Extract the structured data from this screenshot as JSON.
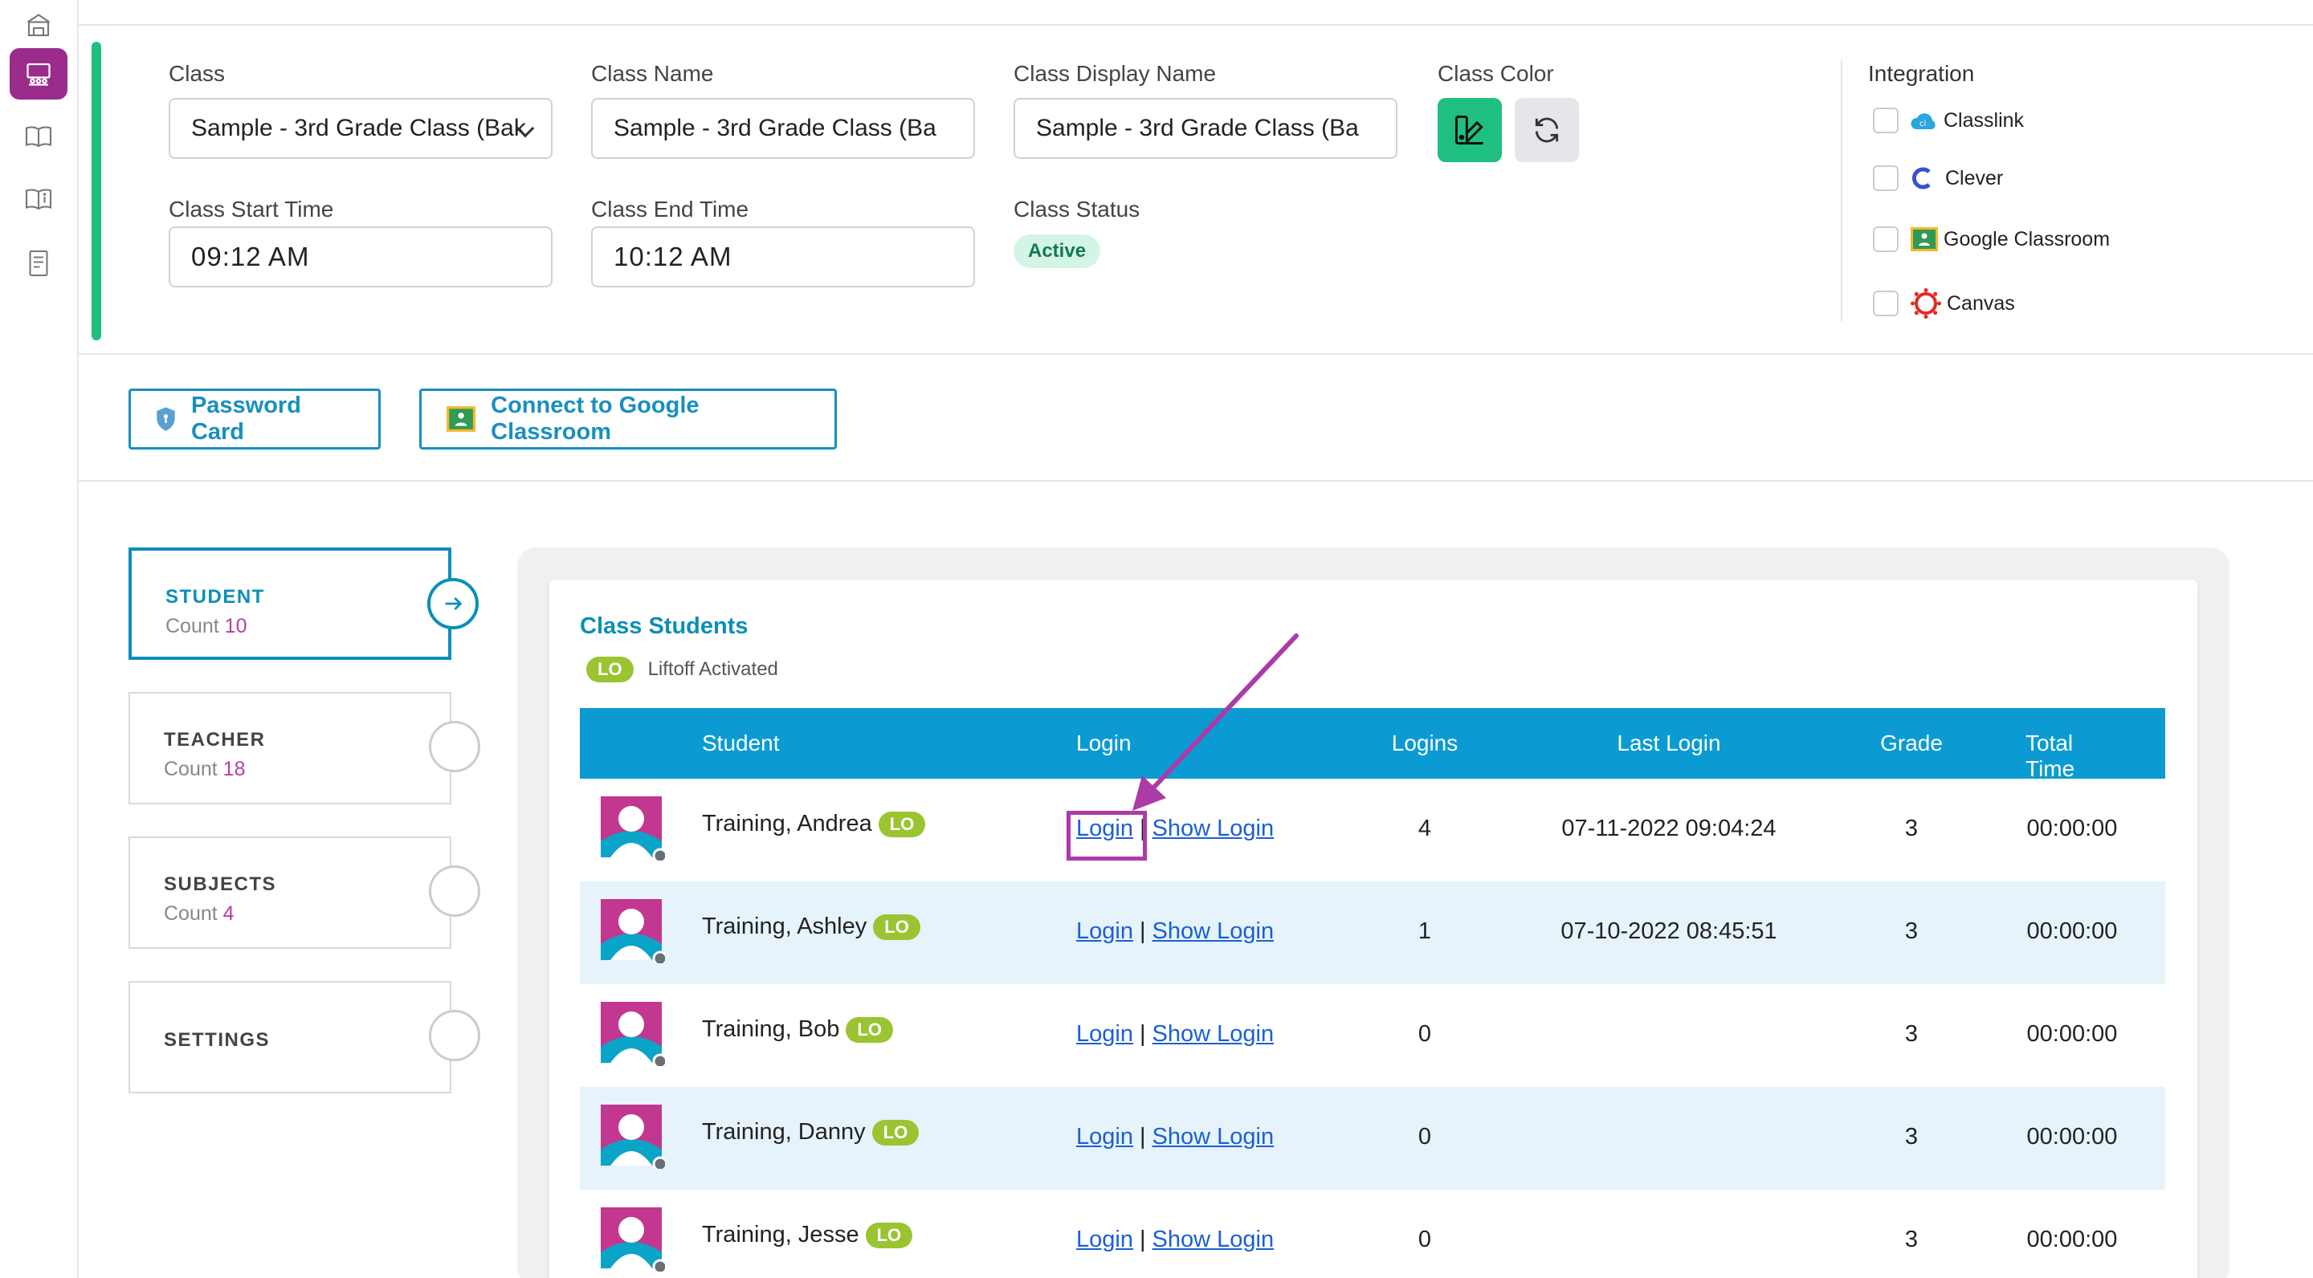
{
  "form": {
    "class_label": "Class",
    "class_value": "Sample - 3rd Grade Class (Bak",
    "class_name_label": "Class Name",
    "class_name_value": "Sample - 3rd Grade Class (Ba",
    "display_name_label": "Class Display Name",
    "display_name_value": "Sample - 3rd Grade Class (Ba",
    "color_label": "Class Color",
    "color_value": "#1fbf7f",
    "start_label": "Class Start Time",
    "start_value": "09:12 AM",
    "end_label": "Class End Time",
    "end_value": "10:12 AM",
    "status_label": "Class Status",
    "status_value": "Active"
  },
  "integration": {
    "title": "Integration",
    "items": [
      "Classlink",
      "Clever",
      "Google Classroom",
      "Canvas"
    ]
  },
  "actions": {
    "password_card": "Password Card",
    "connect_google": "Connect to Google Classroom"
  },
  "tabs": [
    {
      "title": "STUDENT",
      "count_label": "Count",
      "count": "10"
    },
    {
      "title": "TEACHER",
      "count_label": "Count",
      "count": "18"
    },
    {
      "title": "SUBJECTS",
      "count_label": "Count",
      "count": "4"
    },
    {
      "title": "SETTINGS"
    }
  ],
  "students": {
    "title": "Class Students",
    "lo_badge": "LO",
    "lo_legend": "Liftoff Activated",
    "columns": [
      "Student",
      "Login",
      "Logins",
      "Last Login",
      "Grade",
      "Total Time"
    ],
    "login_link": "Login",
    "separator": "|",
    "show_login_link": "Show Login",
    "rows": [
      {
        "name": "Training, Andrea",
        "logins": "4",
        "last_login": "07-11-2022 09:04:24",
        "grade": "3",
        "total_time": "00:00:00"
      },
      {
        "name": "Training, Ashley",
        "logins": "1",
        "last_login": "07-10-2022 08:45:51",
        "grade": "3",
        "total_time": "00:00:00"
      },
      {
        "name": "Training, Bob",
        "logins": "0",
        "last_login": "",
        "grade": "3",
        "total_time": "00:00:00"
      },
      {
        "name": "Training, Danny",
        "logins": "0",
        "last_login": "",
        "grade": "3",
        "total_time": "00:00:00"
      },
      {
        "name": "Training, Jesse",
        "logins": "0",
        "last_login": "",
        "grade": "3",
        "total_time": "00:00:00"
      }
    ]
  },
  "colors": {
    "accent_blue": "#0b9bd2",
    "brand_purple": "#9b2c8c",
    "lo_green": "#9ac431",
    "annotation": "#ac3aa8"
  }
}
